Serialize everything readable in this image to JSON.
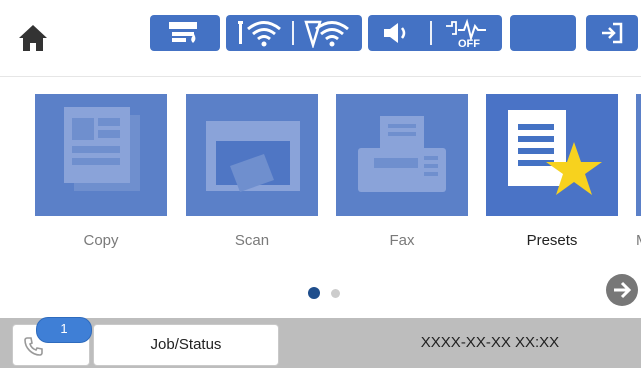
{
  "top_bar": {
    "icons": [
      "home-icon",
      "paper-setting-icon",
      "wifi-direct-icon",
      "wifi-icon",
      "sound-icon",
      "silent-off-icon",
      "sleep-icon",
      "logout-icon"
    ]
  },
  "apps": [
    {
      "label": "Copy",
      "icon": "copy-icon"
    },
    {
      "label": "Scan",
      "icon": "scan-icon"
    },
    {
      "label": "Fax",
      "icon": "fax-icon"
    },
    {
      "label": "Presets",
      "icon": "presets-icon"
    },
    {
      "label": "M",
      "icon": "partial-app-icon"
    }
  ],
  "pager": {
    "pages": 2,
    "current": 1
  },
  "bottom_bar": {
    "fax_badge": "1",
    "job_status": "Job/Status",
    "datetime": "XXXX-XX-XX XX:XX"
  },
  "colors": {
    "accent": "#4472c4",
    "tile": "#4f76c4",
    "badge": "#3f7fd6"
  }
}
